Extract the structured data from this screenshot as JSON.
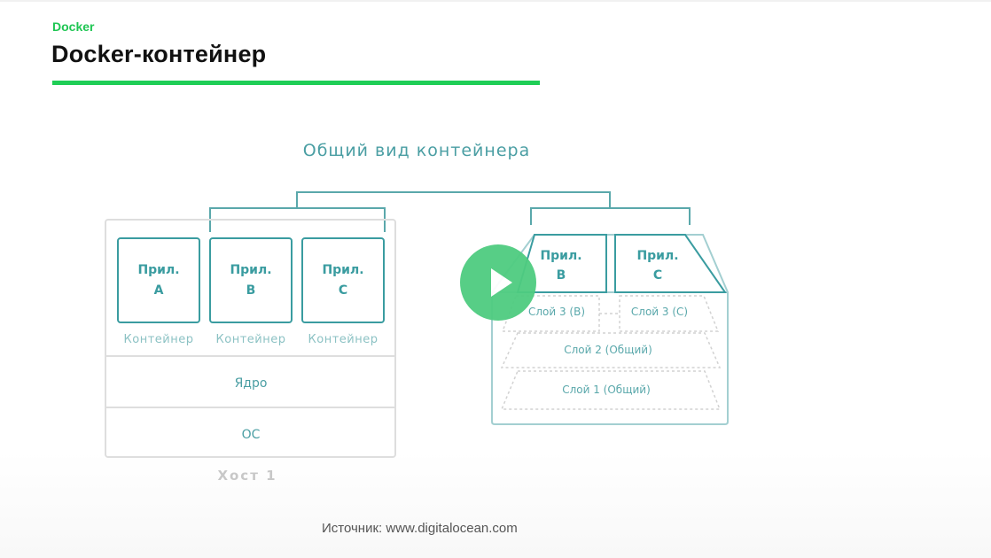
{
  "header": {
    "section_label": "Docker",
    "title": "Docker-контейнер"
  },
  "diagram": {
    "title": "Общий вид контейнера",
    "host": {
      "apps": [
        {
          "line1": "Прил.",
          "line2": "A",
          "caption": "Контейнер"
        },
        {
          "line1": "Прил.",
          "line2": "B",
          "caption": "Контейнер"
        },
        {
          "line1": "Прил.",
          "line2": "C",
          "caption": "Контейнер"
        }
      ],
      "kernel": "Ядро",
      "os": "ОС",
      "label": "Хост 1"
    },
    "image": {
      "apps": [
        {
          "line1": "Прил.",
          "line2": "B"
        },
        {
          "line1": "Прил.",
          "line2": "C"
        }
      ],
      "layers": {
        "layer3_b": "Слой 3 (B)",
        "layer3_c": "Слой 3 (C)",
        "layer2": "Слой 2 (Общий)",
        "layer1": "Слой 1 (Общий)"
      }
    },
    "colors": {
      "teal": "#3a9ca0",
      "light_teal": "#7fbdc0",
      "gray": "#dcdcdc",
      "brand_green": "#1fce56"
    }
  },
  "footer": {
    "source": "Источник: www.digitalocean.com"
  },
  "video": {
    "play_icon": "play-icon"
  }
}
